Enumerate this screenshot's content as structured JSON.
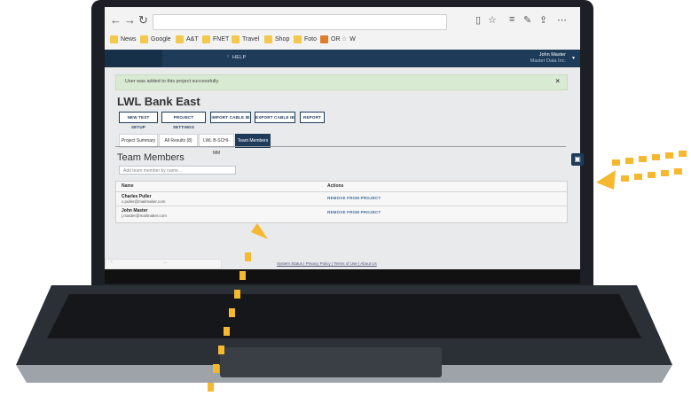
{
  "browser": {
    "url": "",
    "favorites": [
      {
        "label": "News"
      },
      {
        "label": "Google"
      },
      {
        "label": "A&T"
      },
      {
        "label": "FNET"
      },
      {
        "label": "Travel"
      },
      {
        "label": "Shop"
      },
      {
        "label": "Foto"
      },
      {
        "label": "OR"
      },
      {
        "label": "W"
      }
    ]
  },
  "app": {
    "nav_help": "HELP",
    "user_name": "John Master",
    "user_role": "Master Data Inc.",
    "alert_text": "User was added to this project successfully.",
    "alert_close": "×",
    "project_title": "LWL Bank East",
    "buttons": {
      "new_test_setup": "NEW TEST SETUP",
      "project_settings": "PROJECT SETTINGS",
      "import_cable_ib": "IMPORT CABLE IB",
      "export_cable_ib": "EXPORT CABLE IB",
      "report": "REPORT"
    },
    "tabs": [
      "Project Summary",
      "All Results (8)",
      "LWL B-SCHI-MM",
      "Team Members"
    ],
    "members_title": "Team Members",
    "add_placeholder": "Add team member by name...",
    "table": {
      "headers": [
        "Name",
        "Actions"
      ],
      "rows": [
        {
          "name": "Charles Puller",
          "email": "c.puller@mailmaker.com",
          "action": "REMOVE FROM PROJECT"
        },
        {
          "name": "John Master",
          "email": "j.master@mailmaker.com",
          "action": "REMOVE FROM PROJECT"
        }
      ]
    },
    "footer_links": "System Status | Privacy Policy | Terms of Use | About Us",
    "taskbar_dots": "..."
  },
  "colors": {
    "navy": "#1f3b5a",
    "arrow": "#f5b82e",
    "success": "#d9ead3"
  }
}
